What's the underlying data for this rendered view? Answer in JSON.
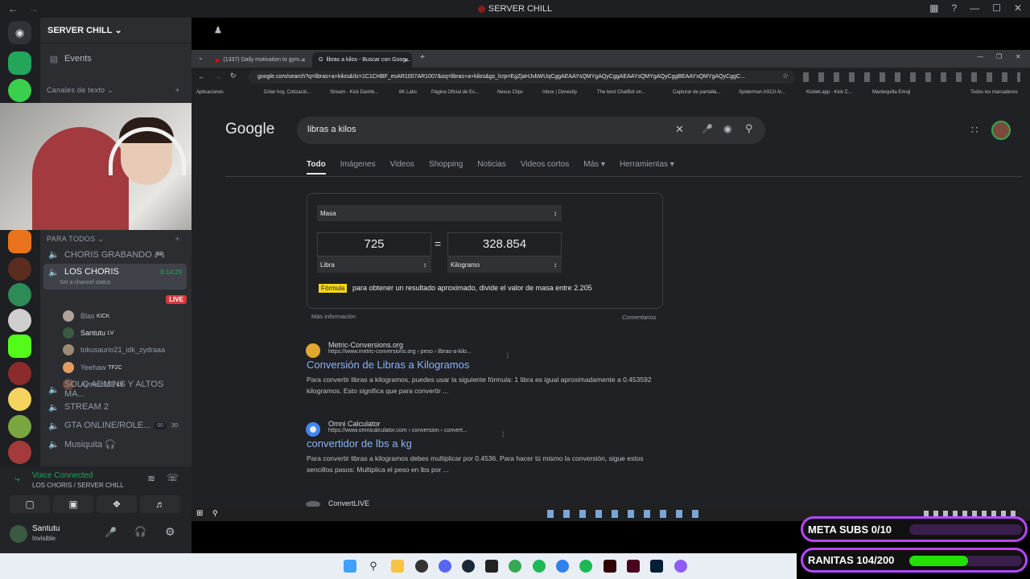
{
  "discord": {
    "window_title": "SERVER CHILL",
    "server_name": "SERVER CHILL",
    "events_label": "Events",
    "text_category": "Canales de texto",
    "voice_category": "PARA TODOS",
    "channels": [
      {
        "name": "CHORIS GRABANDO 🎮"
      },
      {
        "name": "LOS CHORIS",
        "timer": "8:14:29",
        "status": "Set a channel status"
      },
      {
        "name": "SOLO ADMINS Y ALTOS MA..."
      },
      {
        "name": "STREAM 2"
      },
      {
        "name": "GTA ONLINE/ROLE...",
        "count_a": "00",
        "count_b": "30"
      },
      {
        "name": "Musiquita 🎧"
      }
    ],
    "voice_users": [
      {
        "name": "Blas",
        "tag": "KICK",
        "color": "#b1a39a"
      },
      {
        "name": "Santutu",
        "tag": "LV",
        "color": "#3b5a43"
      },
      {
        "name": "tokusaurio21_idk_zydraaa",
        "tag": "",
        "color": "#9d8b74"
      },
      {
        "name": "Yeehaw",
        "tag": "TF2C",
        "color": "#e39c62"
      },
      {
        "name": "Ayman233",
        "tag": "LV",
        "color": "#6e4a3a"
      }
    ],
    "live_badge": "LIVE",
    "voice_connected": "Voice Connected",
    "voice_location": "LOS CHORIS / SERVER CHILL",
    "user_name": "Santutu",
    "user_status": "Invisible"
  },
  "browser": {
    "tabs": [
      {
        "label": "(1337) Daily motivation to gym..."
      },
      {
        "label": "libras a kilos - Buscar con Goog..."
      }
    ],
    "url": "google.com/search?q=libras+a+kilos&rlz=1C1CHBF_esAR1007AR1007&oq=libras+a+kilos&gs_lcrp=EgZjaHJvbWUqCggAEAAYsQMYgAQyCggAEAAYsQMYgAQyCggBEAAYsQMYgAQyCggC...",
    "bookmarks": [
      "Aplicaciones",
      "Dólar hoy, Cotizació...",
      "Stream - Kick Dashb...",
      "6K Labs",
      "Página Oficial de Es...",
      "Nexus Clips",
      "Inbox | Doneclip",
      "The best ChatBot on...",
      "Capturar de pantalla...",
      "Spiderman ASCII Ar...",
      "Kicklet.app - Kick C...",
      "Mantequilla Emoji",
      "Todos los marcadores"
    ]
  },
  "google": {
    "logo": "Google",
    "query": "libras a kilos",
    "tabs": [
      "Todo",
      "Imágenes",
      "Videos",
      "Shopping",
      "Noticias",
      "Videos cortos",
      "Más ▾",
      "Herramientas ▾"
    ],
    "converter": {
      "category": "Masa",
      "from_value": "725",
      "equals": "=",
      "to_value": "328.854",
      "from_unit": "Libra",
      "to_unit": "Kilogramo",
      "formula_label": "Fórmula",
      "formula_text": "para obtener un resultado aproximado, divide el valor de masa entre 2.205",
      "more_info": "Más información",
      "comments": "Comentarios"
    },
    "results": [
      {
        "site": "Metric-Conversions.org",
        "url": "https://www.metric-conversions.org › peso › libras-a-kilo...",
        "title": "Conversión de Libras a Kilogramos",
        "snippet": "Para convertir libras a kilogramos, puedes usar la siguiente fórmula: 1 libra es igual aproximadamente a 0.453592 kilogramos. Esto significa que para convertir ..."
      },
      {
        "site": "Omni Calculator",
        "url": "https://www.omnicalculator.com › conversion › convert...",
        "title": "convertidor de lbs a kg",
        "snippet": "Para convertir libras a kilogramos debes multiplicar por 0.4536. Para hacer tú mismo la conversión, sigue estos sencillos pasos: Multiplica el peso en lbs por ..."
      },
      {
        "site": "ConvertLIVE"
      }
    ]
  },
  "overlays": {
    "meta_subs": "META SUBS 0/10",
    "meta_subs_progress": 0.0,
    "ranitas": "RANITAS 104/200",
    "ranitas_progress": 0.52
  },
  "colors": {
    "accent": "#b646ff",
    "discord_green": "#23a55a",
    "link_blue": "#8ab4f8"
  }
}
